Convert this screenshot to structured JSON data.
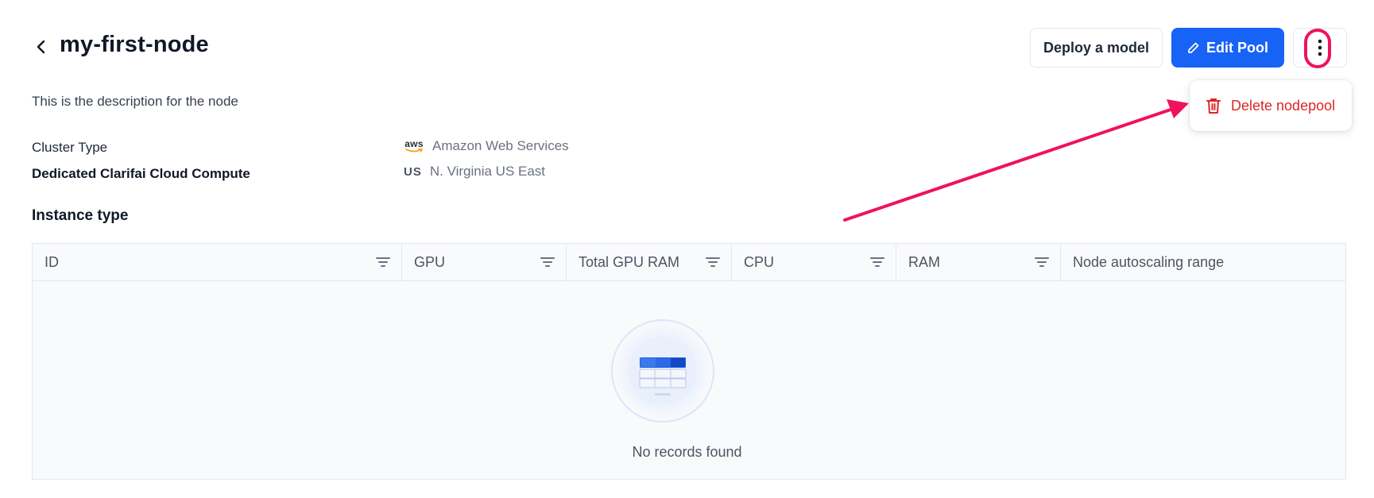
{
  "header": {
    "title": "my-first-node",
    "deploy_label": "Deploy a model",
    "edit_label": "Edit Pool"
  },
  "menu": {
    "delete_label": "Delete nodepool"
  },
  "description": "This is the description for the node",
  "info": {
    "cluster_type_label": "Cluster Type",
    "cluster_type_value": "Amazon Web Services",
    "aws_logo_text": "aws",
    "compute_label": "Dedicated Clarifai Cloud Compute",
    "region_code": "US",
    "region_value": "N. Virginia US East"
  },
  "instance_section_title": "Instance type",
  "table": {
    "columns": [
      "ID",
      "GPU",
      "Total GPU RAM",
      "CPU",
      "RAM",
      "Node autoscaling range"
    ],
    "empty_text": "No records found"
  },
  "colors": {
    "primary": "#1763f5",
    "danger": "#dc2626",
    "annotation": "#f0115f"
  },
  "icons": {
    "back": "chevron-left-icon",
    "edit": "pencil-icon",
    "more": "more-vertical-icon",
    "delete": "trash-icon",
    "filter": "filter-lines-icon"
  }
}
